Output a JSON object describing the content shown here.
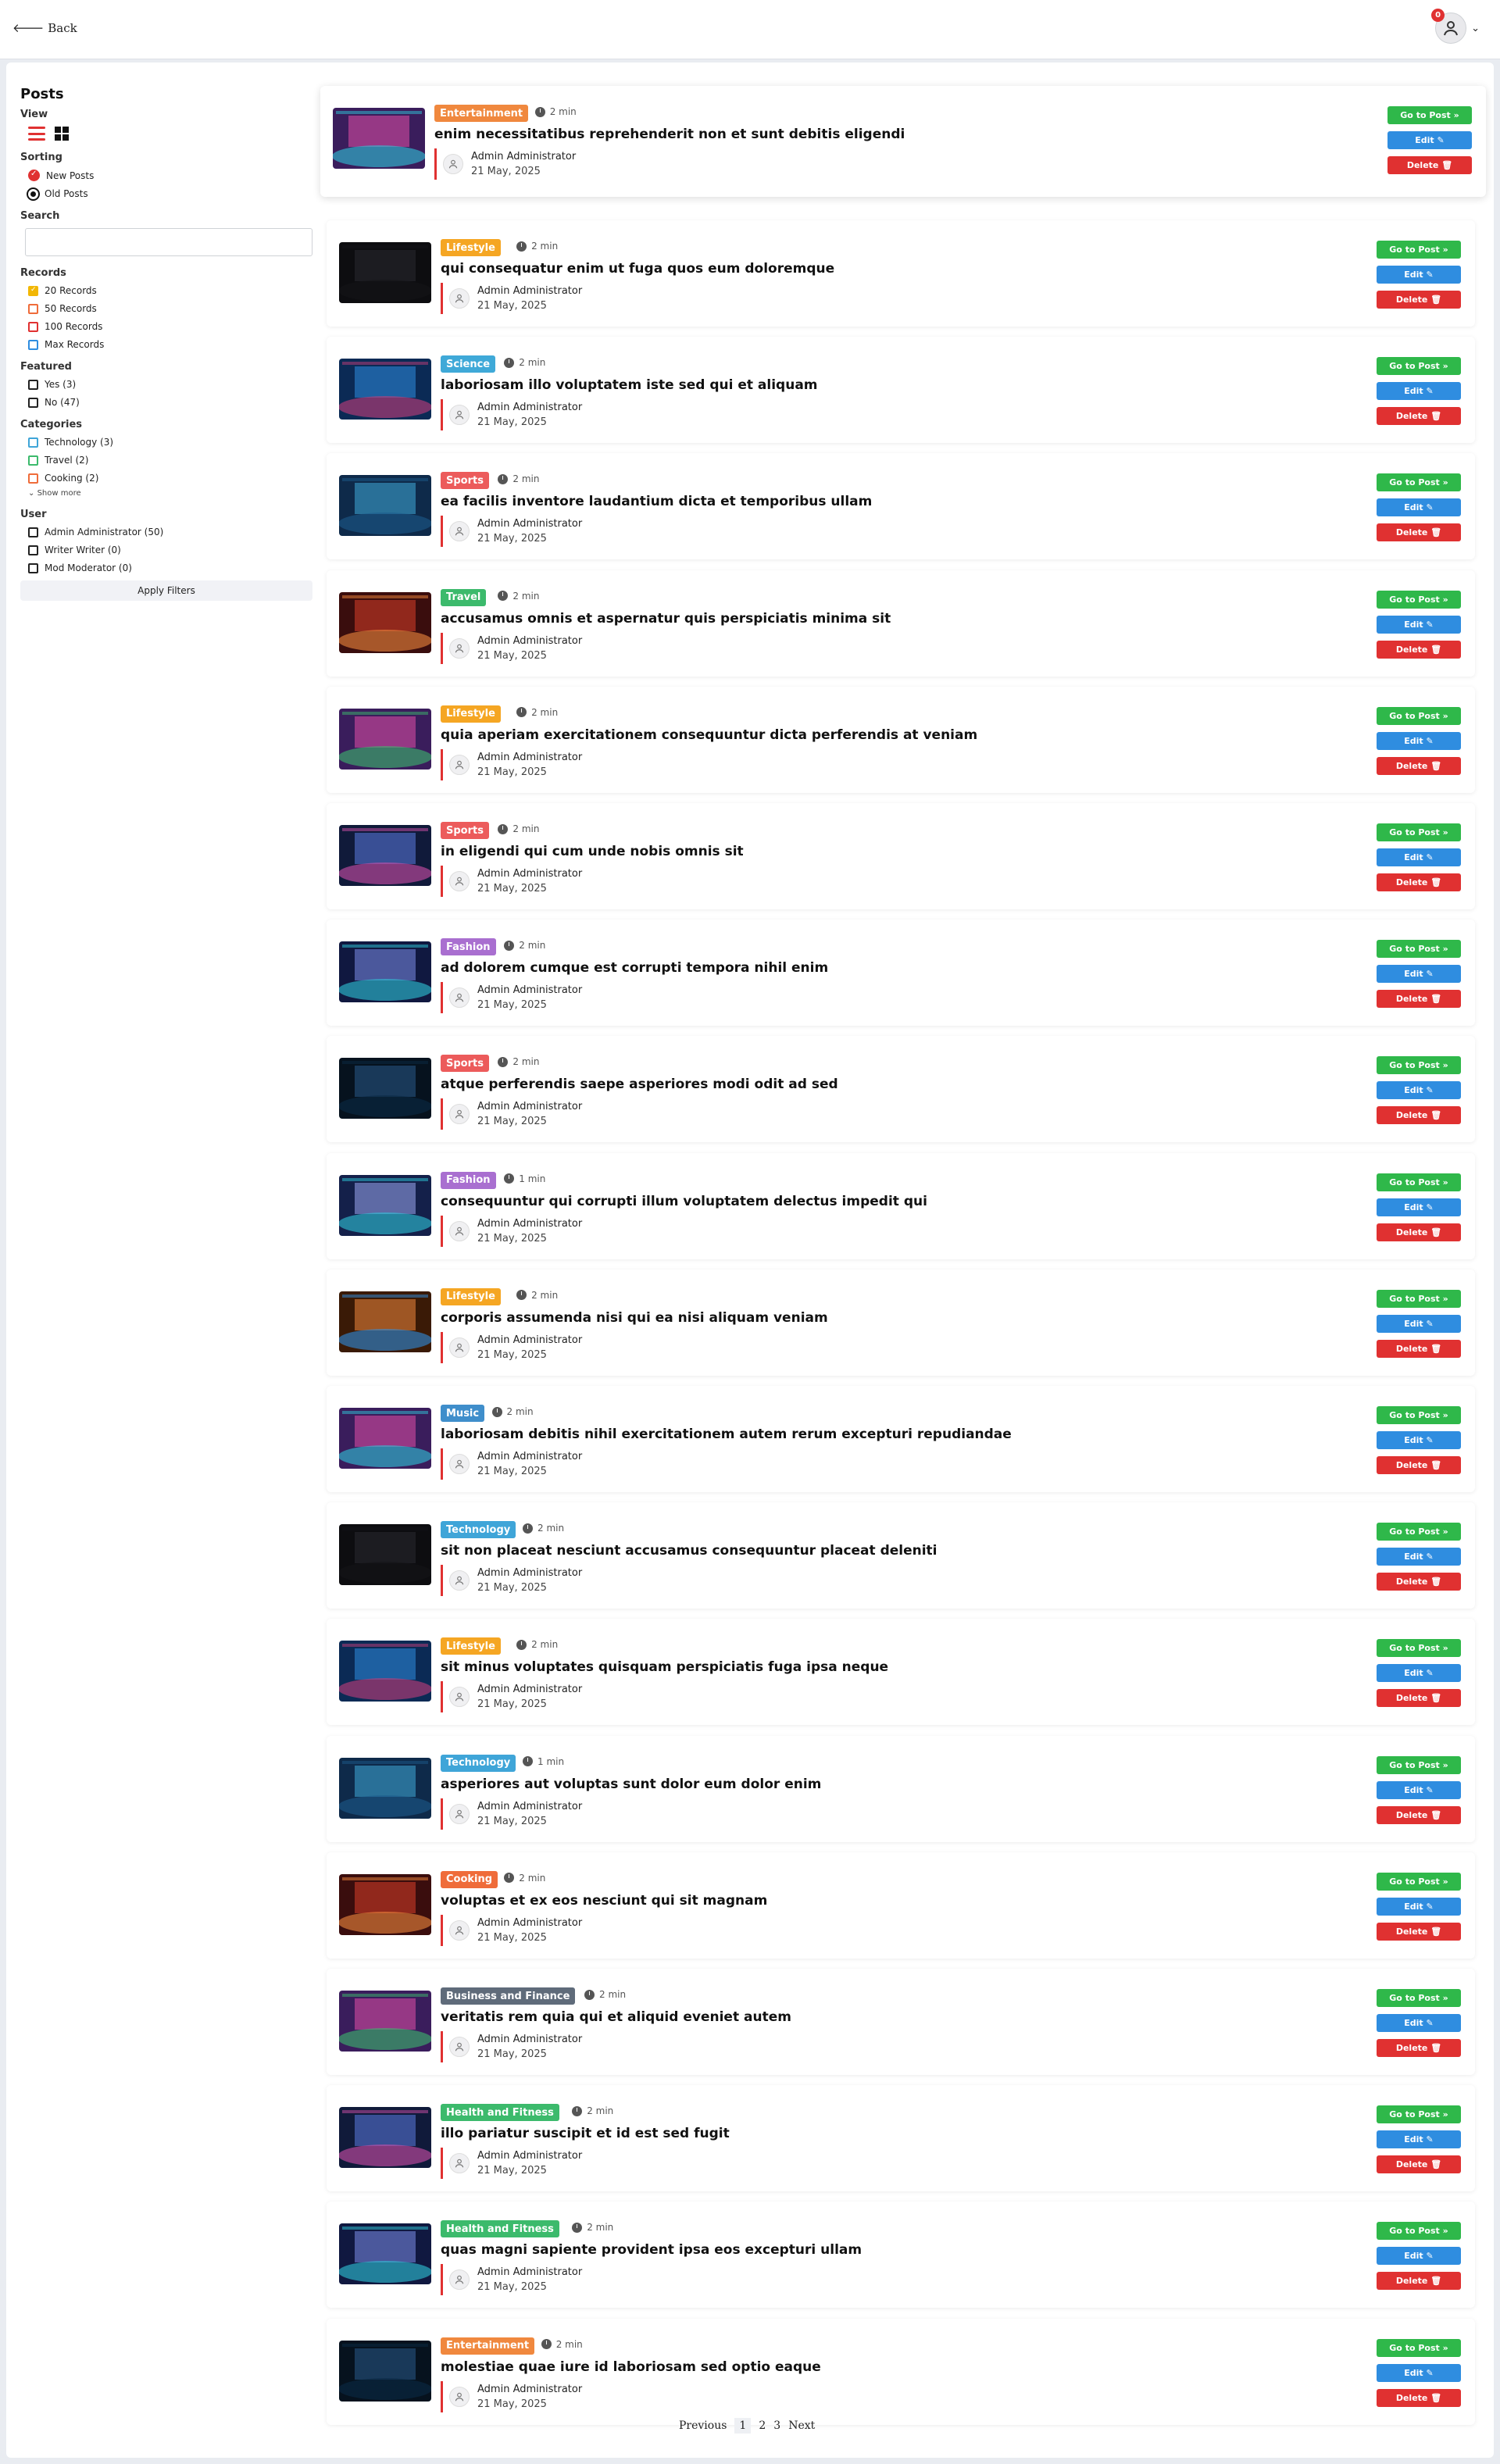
{
  "header": {
    "back_label": "Back",
    "notification_count": "0"
  },
  "sidebar": {
    "title": "Posts",
    "view_label": "View",
    "sorting_label": "Sorting",
    "sort_options": [
      "New Posts",
      "Old Posts"
    ],
    "search_label": "Search",
    "records_label": "Records",
    "records": [
      "20 Records",
      "50 Records",
      "100 Records",
      "Max Records"
    ],
    "featured_label": "Featured",
    "featured": [
      "Yes (3)",
      "No (47)"
    ],
    "categories_label": "Categories",
    "categories": [
      "Technology (3)",
      "Travel (2)",
      "Cooking (2)"
    ],
    "show_more": "Show more",
    "user_label": "User",
    "users": [
      "Admin Administrator (50)",
      "Writer Writer (0)",
      "Mod Moderator (0)"
    ],
    "apply_label": "Apply Filters"
  },
  "colors": {
    "Entertainment": "#f0883e",
    "Lifestyle": "#f5a623",
    "Science": "#3fa9d8",
    "Sports": "#ec5b5b",
    "Travel": "#3cba6c",
    "Fashion": "#a96fd0",
    "Music": "#3f8ecb",
    "Technology": "#3fa5d8",
    "Cooking": "#ef6c3a",
    "Business and Finance": "#5f6b7a",
    "Health and Fitness": "#3cba6c"
  },
  "posts": [
    {
      "category": "Entertainment",
      "time": "2 min",
      "title": "enim necessitatibus reprehenderit non et sunt debitis eligendi",
      "author": "Admin Administrator",
      "date": "21 May, 2025"
    },
    {
      "category": "Lifestyle",
      "time": "2 min",
      "title": "qui consequatur enim ut fuga quos eum doloremque",
      "author": "Admin Administrator",
      "date": "21 May, 2025"
    },
    {
      "category": "Science",
      "time": "2 min",
      "title": "laboriosam illo voluptatem iste sed qui et aliquam",
      "author": "Admin Administrator",
      "date": "21 May, 2025"
    },
    {
      "category": "Sports",
      "time": "2 min",
      "title": "ea facilis inventore laudantium dicta et temporibus ullam",
      "author": "Admin Administrator",
      "date": "21 May, 2025"
    },
    {
      "category": "Travel",
      "time": "2 min",
      "title": "accusamus omnis et aspernatur quis perspiciatis minima sit",
      "author": "Admin Administrator",
      "date": "21 May, 2025"
    },
    {
      "category": "Lifestyle",
      "time": "2 min",
      "title": "quia aperiam exercitationem consequuntur dicta perferendis at veniam",
      "author": "Admin Administrator",
      "date": "21 May, 2025"
    },
    {
      "category": "Sports",
      "time": "2 min",
      "title": "in eligendi qui cum unde nobis omnis sit",
      "author": "Admin Administrator",
      "date": "21 May, 2025"
    },
    {
      "category": "Fashion",
      "time": "2 min",
      "title": "ad dolorem cumque est corrupti tempora nihil enim",
      "author": "Admin Administrator",
      "date": "21 May, 2025"
    },
    {
      "category": "Sports",
      "time": "2 min",
      "title": "atque perferendis saepe asperiores modi odit ad sed",
      "author": "Admin Administrator",
      "date": "21 May, 2025"
    },
    {
      "category": "Fashion",
      "time": "1 min",
      "title": "consequuntur qui corrupti illum voluptatem delectus impedit qui",
      "author": "Admin Administrator",
      "date": "21 May, 2025"
    },
    {
      "category": "Lifestyle",
      "time": "2 min",
      "title": "corporis assumenda nisi qui ea nisi aliquam veniam",
      "author": "Admin Administrator",
      "date": "21 May, 2025"
    },
    {
      "category": "Music",
      "time": "2 min",
      "title": "laboriosam debitis nihil exercitationem autem rerum excepturi repudiandae",
      "author": "Admin Administrator",
      "date": "21 May, 2025"
    },
    {
      "category": "Technology",
      "time": "2 min",
      "title": "sit non placeat nesciunt accusamus consequuntur placeat deleniti",
      "author": "Admin Administrator",
      "date": "21 May, 2025"
    },
    {
      "category": "Lifestyle",
      "time": "2 min",
      "title": "sit minus voluptates quisquam perspiciatis fuga ipsa neque",
      "author": "Admin Administrator",
      "date": "21 May, 2025"
    },
    {
      "category": "Technology",
      "time": "1 min",
      "title": "asperiores aut voluptas sunt dolor eum dolor enim",
      "author": "Admin Administrator",
      "date": "21 May, 2025"
    },
    {
      "category": "Cooking",
      "time": "2 min",
      "title": "voluptas et ex eos nesciunt qui sit magnam",
      "author": "Admin Administrator",
      "date": "21 May, 2025"
    },
    {
      "category": "Business and Finance",
      "time": "2 min",
      "title": "veritatis rem quia qui et aliquid eveniet autem",
      "author": "Admin Administrator",
      "date": "21 May, 2025"
    },
    {
      "category": "Health and Fitness",
      "time": "2 min",
      "title": "illo pariatur suscipit et id est sed fugit",
      "author": "Admin Administrator",
      "date": "21 May, 2025"
    },
    {
      "category": "Health and Fitness",
      "time": "2 min",
      "title": "quas magni sapiente provident ipsa eos excepturi ullam",
      "author": "Admin Administrator",
      "date": "21 May, 2025"
    },
    {
      "category": "Entertainment",
      "time": "2 min",
      "title": "molestiae quae iure id laboriosam sed optio eaque",
      "author": "Admin Administrator",
      "date": "21 May, 2025"
    }
  ],
  "actions": {
    "go": "Go to Post »",
    "edit": "Edit ✎",
    "delete": "Delete 🗑"
  },
  "pagination": {
    "previous": "Previous",
    "pages": [
      "1",
      "2",
      "3"
    ],
    "next": "Next"
  }
}
